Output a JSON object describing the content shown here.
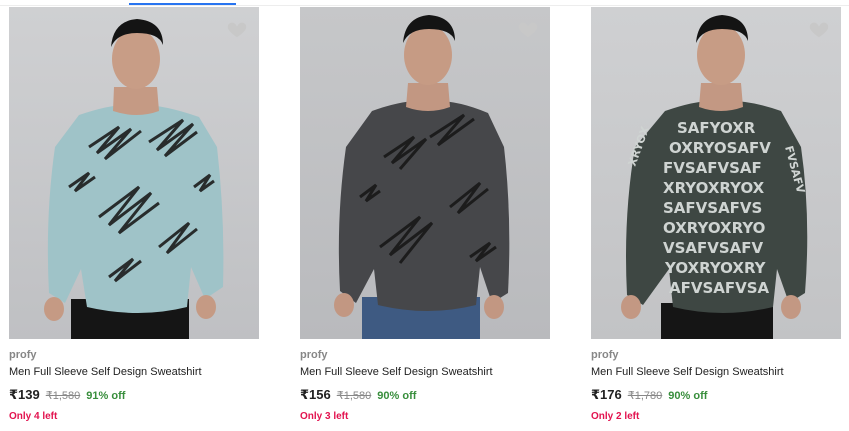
{
  "theme": {
    "accent": "#2874f0",
    "discount_green": "#388e3c",
    "stock_red": "#e2134f",
    "wishlist_heart": "#c8c8c8"
  },
  "products": [
    {
      "image_desc": "light-blue-scribble-sweatshirt",
      "brand": "profy",
      "title": "Men Full Sleeve Self Design Sweatshirt",
      "price": "₹139",
      "mrp": "₹1,580",
      "discount": "91% off",
      "stock": "Only 4 left",
      "sweater_color": "#9fc3c8"
    },
    {
      "image_desc": "dark-grey-scribble-sweatshirt",
      "brand": "profy",
      "title": "Men Full Sleeve Self Design Sweatshirt",
      "price": "₹156",
      "mrp": "₹1,580",
      "discount": "90% off",
      "stock": "Only 3 left",
      "sweater_color": "#46474a"
    },
    {
      "image_desc": "dark-green-letter-print-sweatshirt",
      "brand": "profy",
      "title": "Men Full Sleeve Self Design Sweatshirt",
      "price": "₹176",
      "mrp": "₹1,780",
      "discount": "90% off",
      "stock": "Only 2 left",
      "sweater_color": "#3e4743"
    }
  ]
}
